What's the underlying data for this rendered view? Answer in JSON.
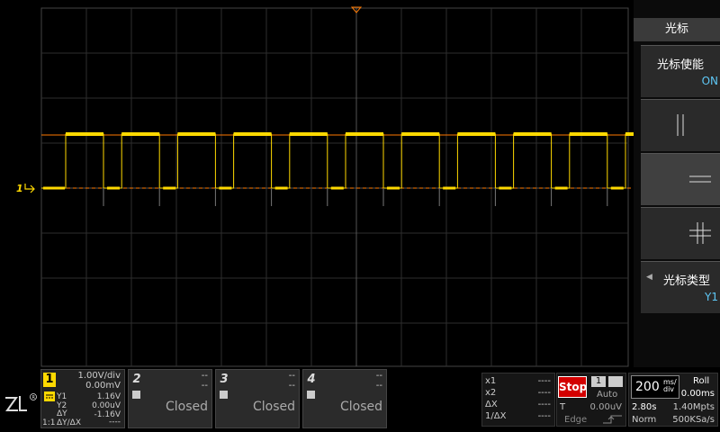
{
  "menu": {
    "title": "光标",
    "items": [
      {
        "label": "光标使能",
        "value": "ON"
      },
      {
        "label": "",
        "value": ""
      },
      {
        "label": "",
        "value": ""
      },
      {
        "label": "",
        "value": ""
      },
      {
        "label": "光标类型",
        "value": "Y1"
      }
    ]
  },
  "channels": [
    {
      "num": "1",
      "volts_div": "1.00V/div",
      "offset": "0.00mV",
      "y1_label": "Y1",
      "y1": "1.16V",
      "y2_label": "Y2",
      "y2": "0.00uV",
      "dy_label": "ΔY",
      "dy": "-1.16V",
      "ratio_label": "1:1",
      "ratio2_label": "ΔY/ΔX",
      "ratio2_value": "----",
      "color": "#ffd900"
    },
    {
      "num": "2",
      "r1": "--",
      "r2": "--",
      "status": "Closed",
      "color": "#ccc"
    },
    {
      "num": "3",
      "r1": "--",
      "r2": "--",
      "status": "Closed",
      "color": "#ccc"
    },
    {
      "num": "4",
      "r1": "--",
      "r2": "--",
      "status": "Closed",
      "color": "#ccc"
    }
  ],
  "cursor_panel": {
    "x1_label": "x1",
    "x1": "----",
    "x2_label": "x2",
    "x2": "----",
    "dx_label": "ΔX",
    "dx": "----",
    "inv_label": "1/ΔX",
    "inv": "----"
  },
  "run": {
    "state": "Stop",
    "trig_src": "1",
    "mode": "Auto",
    "t_label": "T",
    "t_value": "0.00uV",
    "edge_label": "Edge"
  },
  "timebase": {
    "value": "200",
    "unit": "ms/div",
    "roll": "Roll",
    "offset": "0.00ms",
    "window": "2.80s",
    "mpts": "1.40Mpts",
    "acq": "Norm",
    "rate": "500KSa/s"
  },
  "scope": {
    "ch1_marker": "1",
    "trace_color": "#ffd900",
    "cursor_color": "#ff7a00"
  }
}
